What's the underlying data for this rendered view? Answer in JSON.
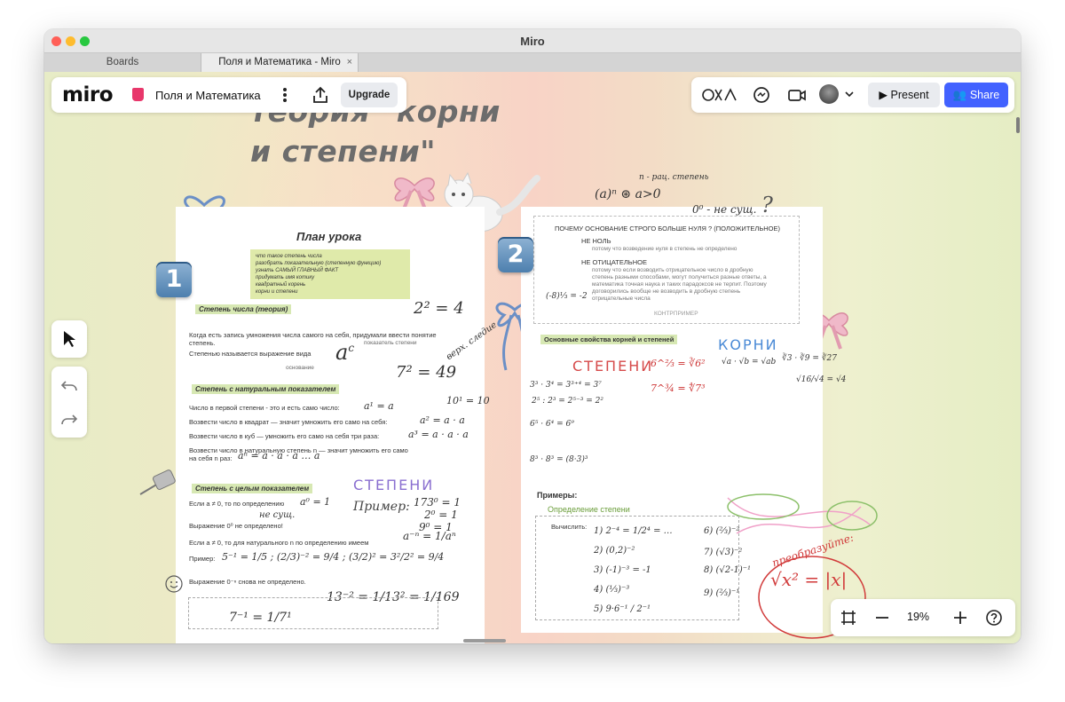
{
  "window": {
    "title": "Miro"
  },
  "tabs": [
    {
      "label": "Boards"
    },
    {
      "label": "Поля и Математика - Miro",
      "close": "×"
    }
  ],
  "toolbar_left": {
    "logo": "miro",
    "board_name": "Поля и Математика",
    "upgrade_label": "Upgrade"
  },
  "toolbar_right": {
    "present_label": "Present",
    "share_label": "Share"
  },
  "zoom": {
    "value": "19%"
  },
  "board": {
    "title_line1": "теория \"корни",
    "title_line2": "и степени\"",
    "page1": {
      "badge": "1",
      "lesson_title": "План урока",
      "lesson_items": [
        "что такое степень числа",
        "разобрать показательную (степенную функцию)",
        "узнать САМЫЙ ГЛАВНЫЙ ФАКТ",
        "придумать имя котику",
        "квадратный корень",
        "корни и степени"
      ],
      "section1": "Степень числа (теория)",
      "s1_line1": "Когда есть запись умножения числа самого на себя, придумали ввести понятие",
      "s1_line1b": "степень.",
      "s1_line2": "Степенью называется выражение вида",
      "label_base": "основание",
      "label_exp": "показатель степени",
      "section2": "Степень с натуральным показателем",
      "s2_line1": "Число в первой степени - это и есть само число:",
      "s2_line2": "Возвести число в квадрат — значит умножить его само на себя:",
      "s2_line3": "Возвести число в куб — умножить его само на себя три раза:",
      "s2_line4": "Возвести число в натуральную степень n — значит умножить его само",
      "s2_line4b": "на себя n раз:",
      "section3": "Степень с целым показателем",
      "s3_line1": "Если a ≠ 0, то по определению",
      "s3_line2": "Выражение 0⁰ не определено!",
      "s3_line3": "Если a ≠ 0, то для натурального n по определению имеем",
      "s3_line4": "Пример:",
      "s3_line5": "Выражение 0⁻ⁿ снова не определено.",
      "hand_stepeni": "СТЕПЕНИ",
      "hand_primer": "Пример:",
      "hand_ne_sush": "не сущ."
    },
    "page2": {
      "badge": "2",
      "q_title": "ПОЧЕМУ ОСНОВАНИЕ СТРОГО БОЛЬШЕ НУЛЯ ? (ПОЛОЖИТЕЛЬНОЕ)",
      "q1": "НЕ НОЛЬ",
      "q1_text": "потому что возведение нуля в степень не определено",
      "q2": "НЕ ОТИЦАТЕЛЬНОЕ",
      "q2_text": "потому что если возводить отрицательное число в дробную степень разными способами, могут получиться разные ответы, а математика точная наука и таких парадоксов не терпит. Поэтому договорились вообще не возводить в дробную степень отрицательные числа",
      "q2_contr": "КОНТРПРИМЕР",
      "section_props": "Основные свойства корней и степеней",
      "hand_stepeni": "СТЕПЕНИ",
      "hand_korni": "КОРНИ",
      "primery": "Примеры:",
      "def_stepeni": "Определение степени",
      "vychislit": "Вычислить:",
      "hand_preobrazuite": "преобразуйте:"
    },
    "annotations": {
      "top_note": "n - рац. степень",
      "zero_note": "0⁰ - не сущ.",
      "verh_sled": "верх. следие"
    }
  }
}
